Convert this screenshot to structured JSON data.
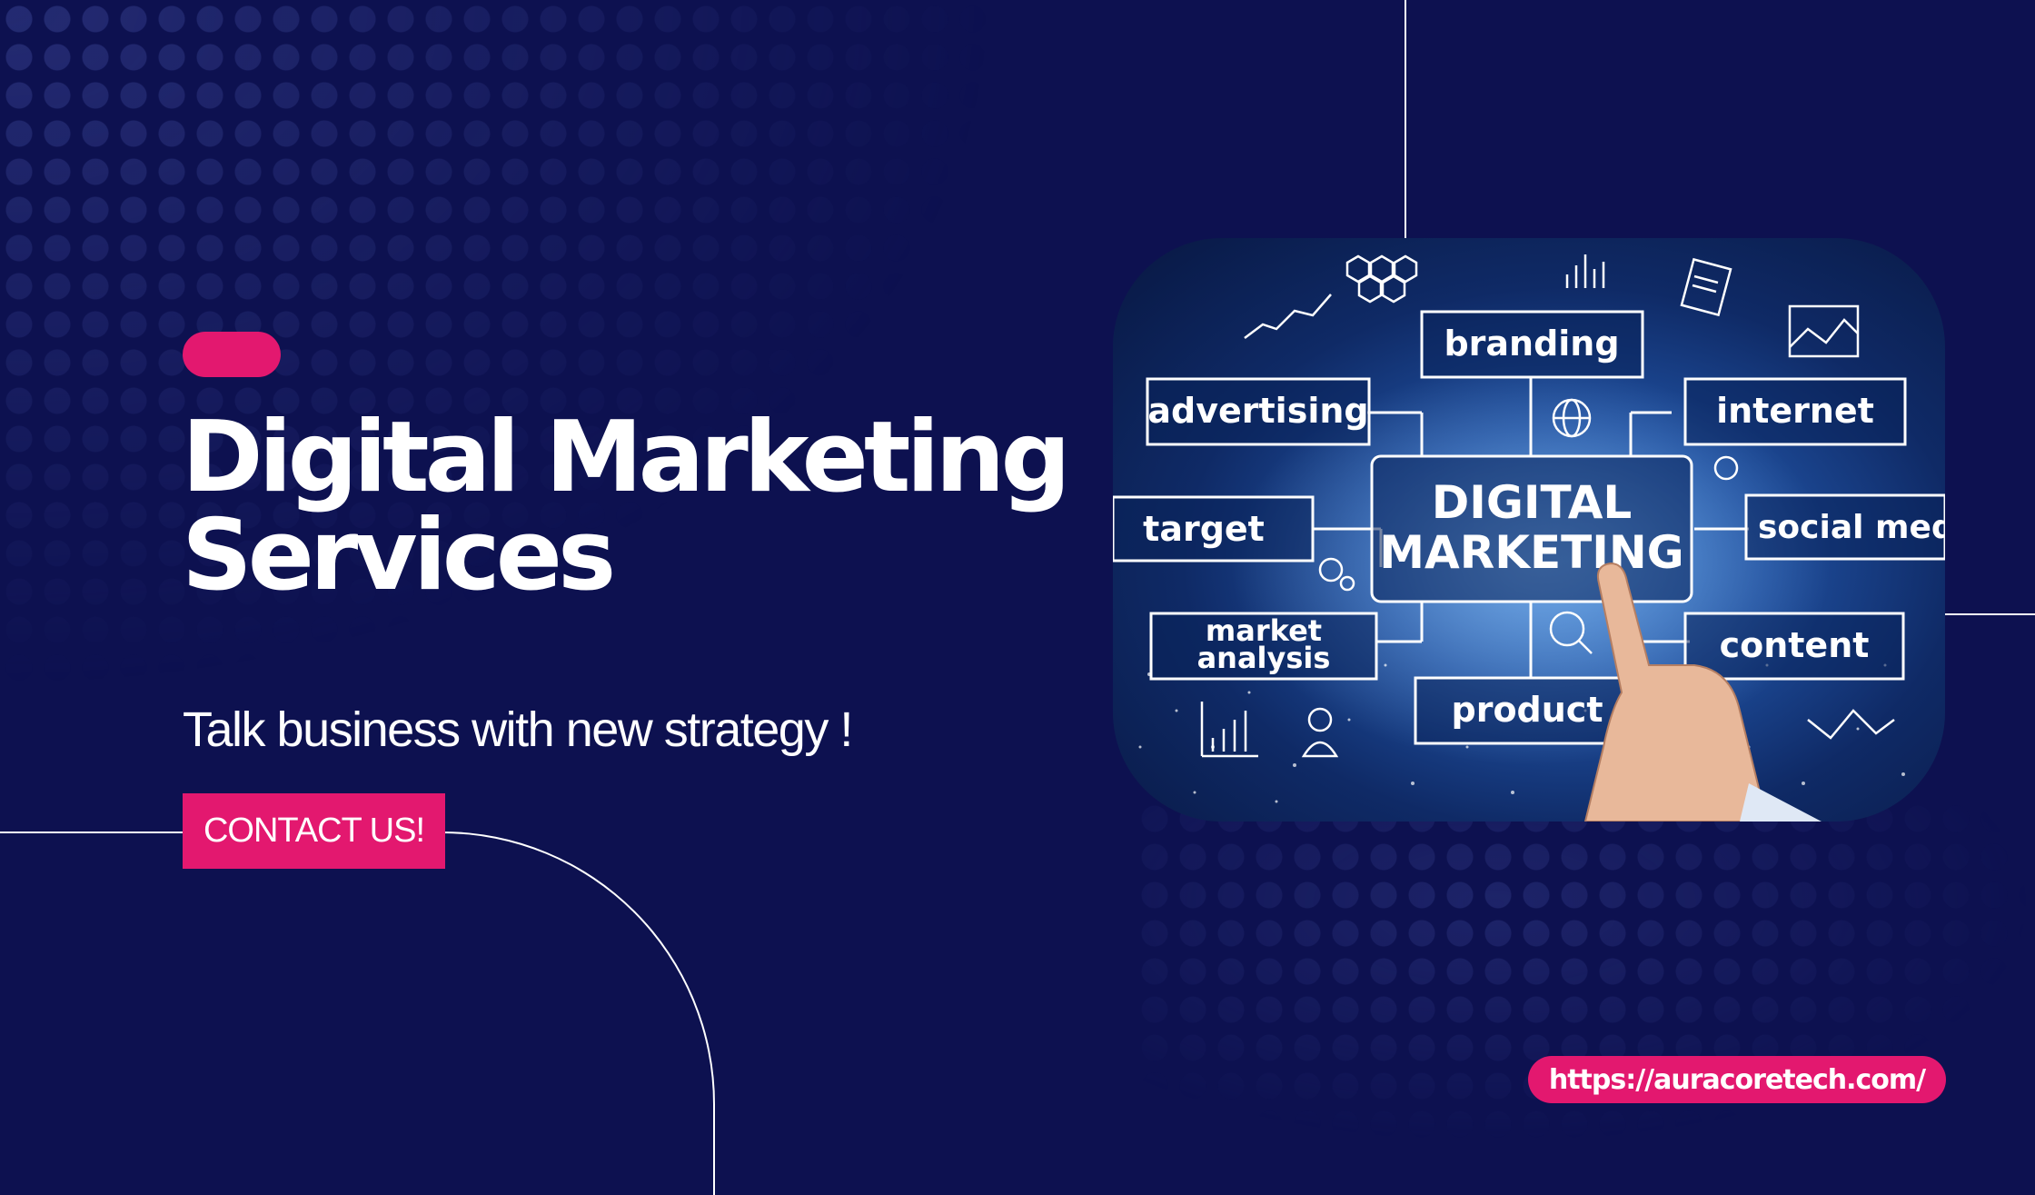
{
  "heading": {
    "line1": "Digital Marketing",
    "line2": "Services"
  },
  "tagline": "Talk business with new strategy !",
  "cta": {
    "label": "CONTACT US!"
  },
  "website": {
    "url": "https://auracoretech.com/"
  },
  "illustration": {
    "center_line1": "DIGITAL",
    "center_line2": "MARKETING",
    "labels": {
      "branding": "branding",
      "advertising": "advertising",
      "internet": "internet",
      "target": "target",
      "social_media": "social medi",
      "market_line1": "market",
      "market_line2": "analysis",
      "content": "content",
      "product": "product"
    }
  },
  "colors": {
    "background": "#0d1150",
    "accent": "#e3186f",
    "text": "#ffffff"
  }
}
